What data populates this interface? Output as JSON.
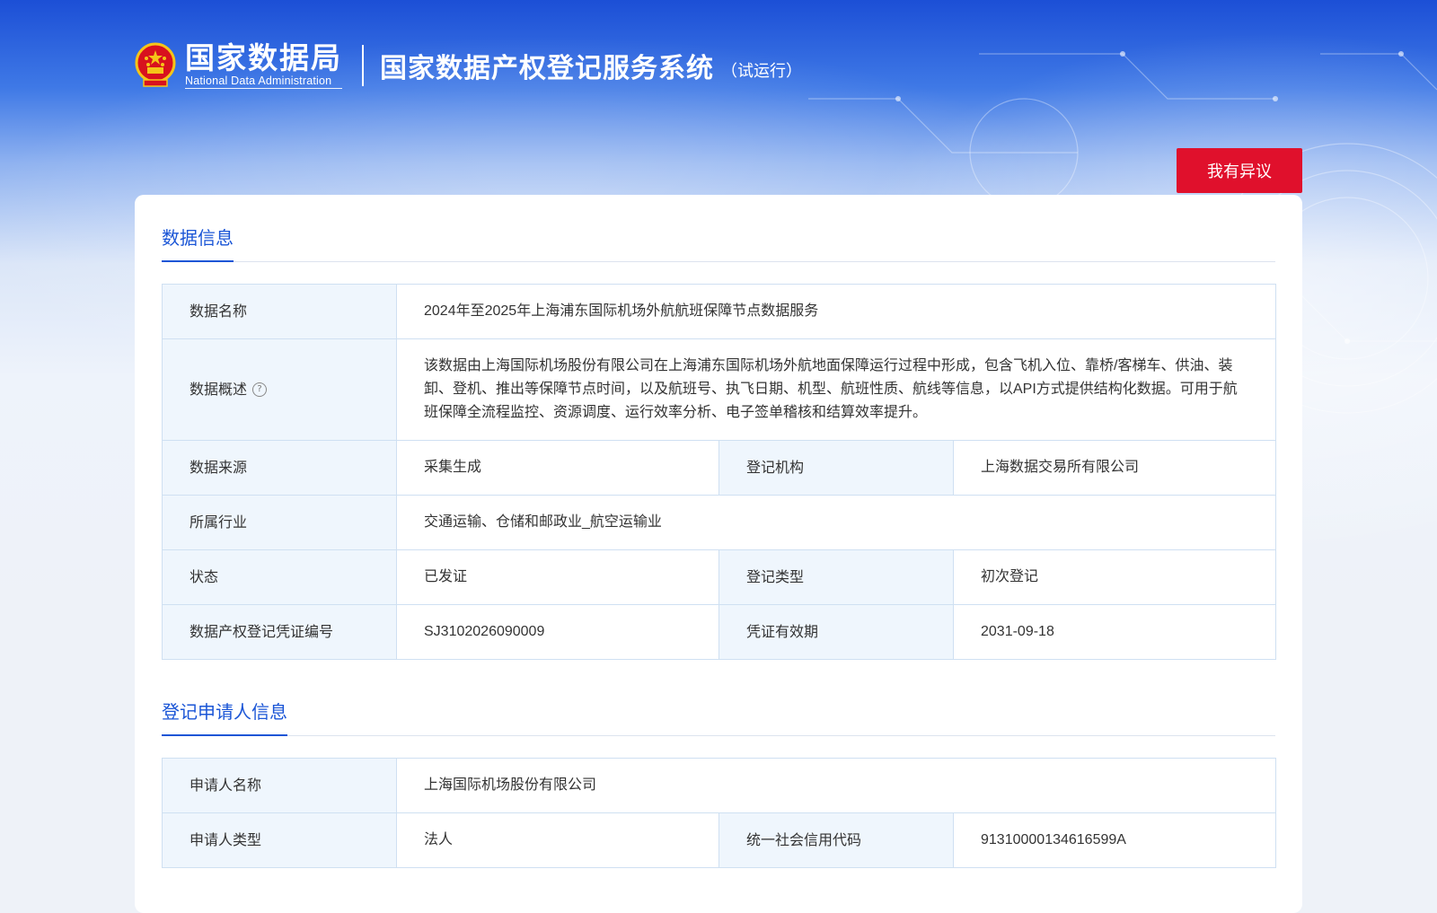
{
  "header": {
    "agency_name_cn": "国家数据局",
    "agency_name_en": "National Data Administration",
    "system_title": "国家数据产权登记服务系统",
    "system_suffix": "（试运行）"
  },
  "actions": {
    "objection_label": "我有异议"
  },
  "data_info": {
    "section_title": "数据信息",
    "rows": {
      "name": {
        "label": "数据名称",
        "value": "2024年至2025年上海浦东国际机场外航航班保障节点数据服务"
      },
      "summary": {
        "label": "数据概述",
        "help_icon": "question-circle-icon",
        "value": "该数据由上海国际机场股份有限公司在上海浦东国际机场外航地面保障运行过程中形成，包含飞机入位、靠桥/客梯车、供油、装卸、登机、推出等保障节点时间，以及航班号、执飞日期、机型、航班性质、航线等信息，以API方式提供结构化数据。可用于航班保障全流程监控、资源调度、运行效率分析、电子签单稽核和结算效率提升。"
      },
      "source": {
        "label": "数据来源",
        "value": "采集生成"
      },
      "registrar": {
        "label": "登记机构",
        "value": "上海数据交易所有限公司"
      },
      "industry": {
        "label": "所属行业",
        "value": "交通运输、仓储和邮政业_航空运输业"
      },
      "status": {
        "label": "状态",
        "value": "已发证"
      },
      "reg_type": {
        "label": "登记类型",
        "value": "初次登记"
      },
      "cert_no": {
        "label": "数据产权登记凭证编号",
        "value": "SJ3102026090009"
      },
      "validity": {
        "label": "凭证有效期",
        "value": "2031-09-18"
      }
    }
  },
  "applicant_info": {
    "section_title": "登记申请人信息",
    "rows": {
      "name": {
        "label": "申请人名称",
        "value": "上海国际机场股份有限公司"
      },
      "type": {
        "label": "申请人类型",
        "value": "法人"
      },
      "credit_code": {
        "label": "统一社会信用代码",
        "value": "91310000134616599A"
      }
    }
  },
  "colors": {
    "primary_blue": "#1a55d6",
    "danger_red": "#e0102c",
    "label_bg": "#eff6fd",
    "border": "#cfe0f2",
    "emblem_red": "#d8111e",
    "emblem_gold": "#f5c518"
  }
}
